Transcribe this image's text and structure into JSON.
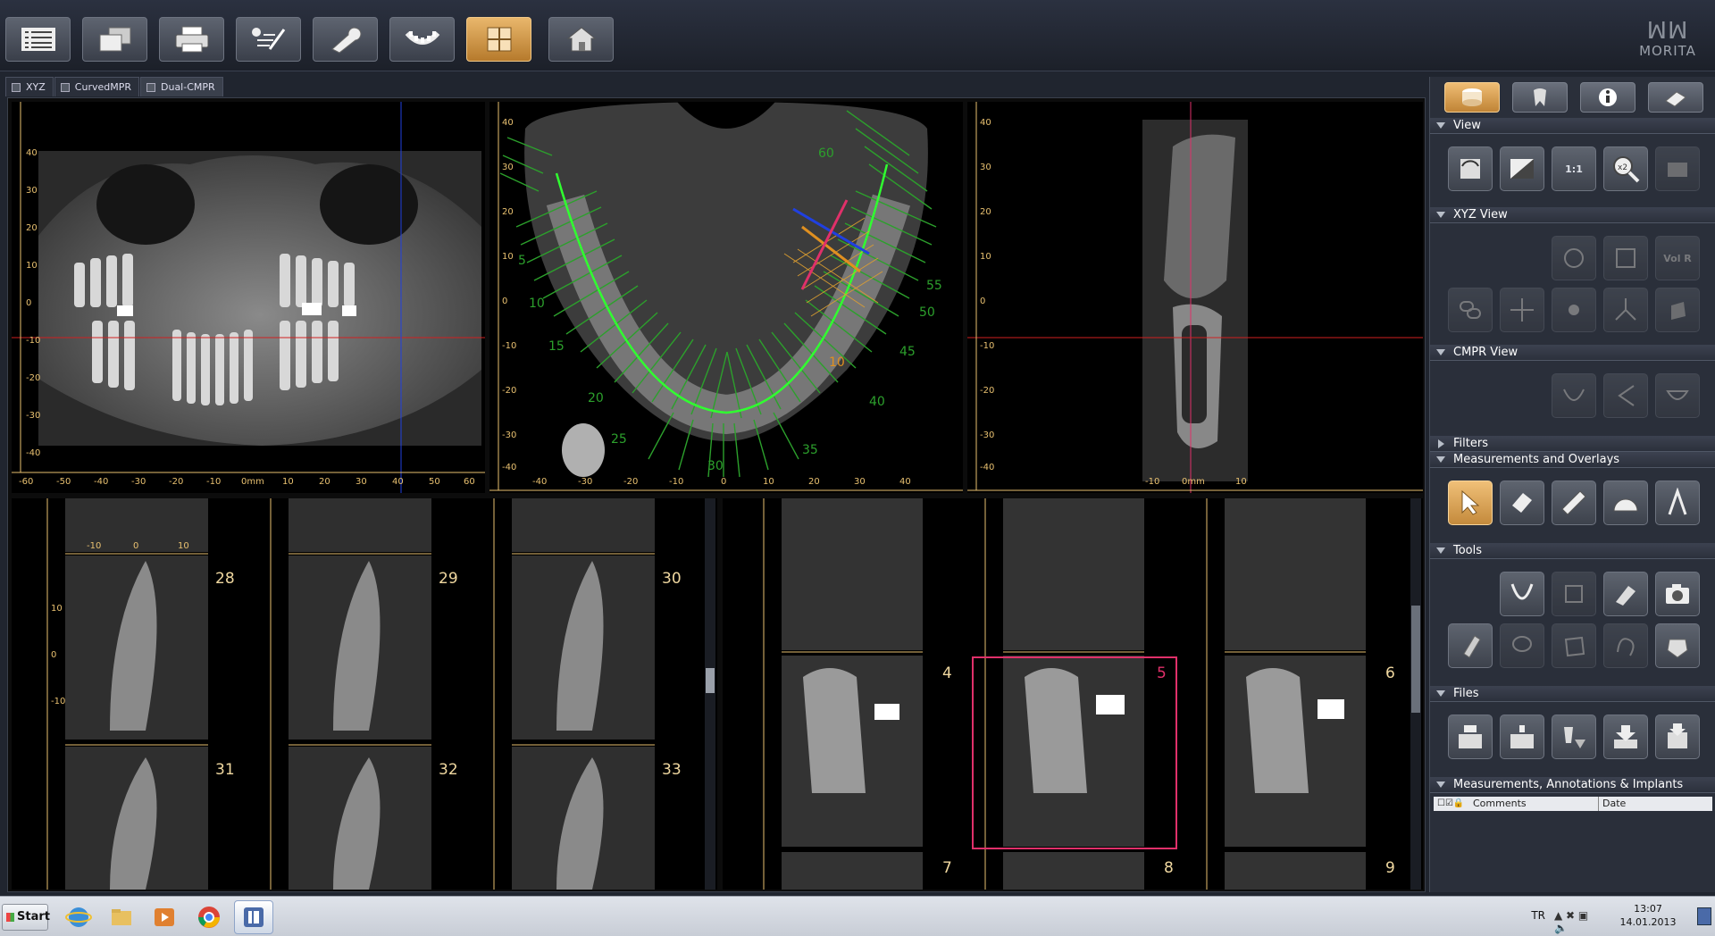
{
  "toolbar": {
    "buttons": [
      {
        "name": "patient-list-icon",
        "active": false
      },
      {
        "name": "windows-icon",
        "active": false
      },
      {
        "name": "printer-icon",
        "active": false
      },
      {
        "name": "report-icon",
        "active": false
      },
      {
        "name": "wrench-icon",
        "active": false
      },
      {
        "name": "dental-arch-icon",
        "active": false
      },
      {
        "name": "cmpr-view-icon",
        "active": true
      },
      {
        "name": "home-icon",
        "active": false
      }
    ],
    "brand": "MORITA"
  },
  "tabs": [
    {
      "label": "XYZ",
      "active": false
    },
    {
      "label": "CurvedMPR",
      "active": false
    },
    {
      "label": "Dual-CMPR",
      "active": true
    }
  ],
  "views": {
    "panoramic": {
      "x_ticks": [
        "-60",
        "-50",
        "-40",
        "-30",
        "-20",
        "-10",
        "0mm",
        "10",
        "20",
        "30",
        "40",
        "50",
        "60"
      ],
      "y_ticks": [
        "40",
        "30",
        "20",
        "10",
        "0",
        "-10",
        "-20",
        "-30",
        "-40"
      ]
    },
    "axial": {
      "x_ticks": [
        "-40",
        "-30",
        "-20",
        "-10",
        "0",
        "10",
        "20",
        "30",
        "40"
      ],
      "y_ticks": [
        "40",
        "30",
        "20",
        "10",
        "0",
        "-10",
        "-20",
        "-30",
        "-40"
      ],
      "arch_labels": [
        "5",
        "10",
        "15",
        "20",
        "25",
        "30",
        "35",
        "40",
        "45",
        "50",
        "55",
        "60",
        "10"
      ]
    },
    "cross": {
      "x_ticks": [
        "-10",
        "0mm",
        "10"
      ],
      "y_ticks": [
        "40",
        "30",
        "20",
        "10",
        "0",
        "-10",
        "-20",
        "-30",
        "-40"
      ]
    }
  },
  "slices_left": [
    "28",
    "29",
    "30",
    "31",
    "32",
    "33"
  ],
  "slices_right": [
    "4",
    "5",
    "6",
    "7",
    "8",
    "9"
  ],
  "slice_ticks": {
    "x": [
      "-10",
      "0",
      "10"
    ],
    "y": [
      "10",
      "0",
      "-10"
    ]
  },
  "panel": {
    "top_tabs": [
      "database-icon",
      "tooth-icon",
      "info-icon",
      "eraser-icon"
    ],
    "sections": {
      "view": "View",
      "xyz_view": "XYZ View",
      "cmpr_view": "CMPR View",
      "filters": "Filters",
      "measurements": "Measurements and Overlays",
      "tools": "Tools",
      "files": "Files",
      "annotations": "Measurements, Annotations & Implants"
    },
    "view_buttons": [
      "rotate-view-icon",
      "window-level-icon",
      "one-to-one-icon",
      "zoom-x2-icon",
      "layout-icon"
    ],
    "one_to_one": "1:1",
    "zoom_label": "x2",
    "volr_label": "Vol R",
    "table_headers": {
      "comments": "Comments",
      "date": "Date"
    }
  },
  "taskbar": {
    "start": "Start",
    "language": "TR",
    "time": "13:07",
    "date": "14.01.2013"
  },
  "colors": {
    "accent": "#d89c4c",
    "ruler": "#e8c070",
    "selection": "#e0306a",
    "arch": "#30e040"
  }
}
